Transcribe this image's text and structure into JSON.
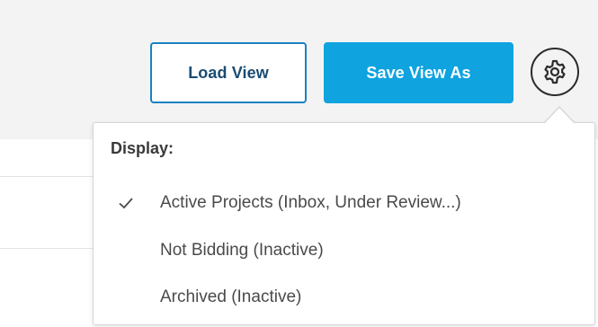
{
  "toolbar": {
    "load_view_label": "Load View",
    "save_view_as_label": "Save View As",
    "settings_icon": "gear-icon"
  },
  "display_menu": {
    "heading": "Display:",
    "items": [
      {
        "label": "Active Projects (Inbox, Under Review...)",
        "checked": true
      },
      {
        "label": "Not Bidding (Inactive)",
        "checked": false
      },
      {
        "label": "Archived (Inactive)",
        "checked": false
      }
    ]
  },
  "colors": {
    "toolbar_background": "#f3f3f3",
    "primary_button": "#0fa3df",
    "outline_button_border": "#1a81c2",
    "outline_button_text": "#1a4c73"
  }
}
